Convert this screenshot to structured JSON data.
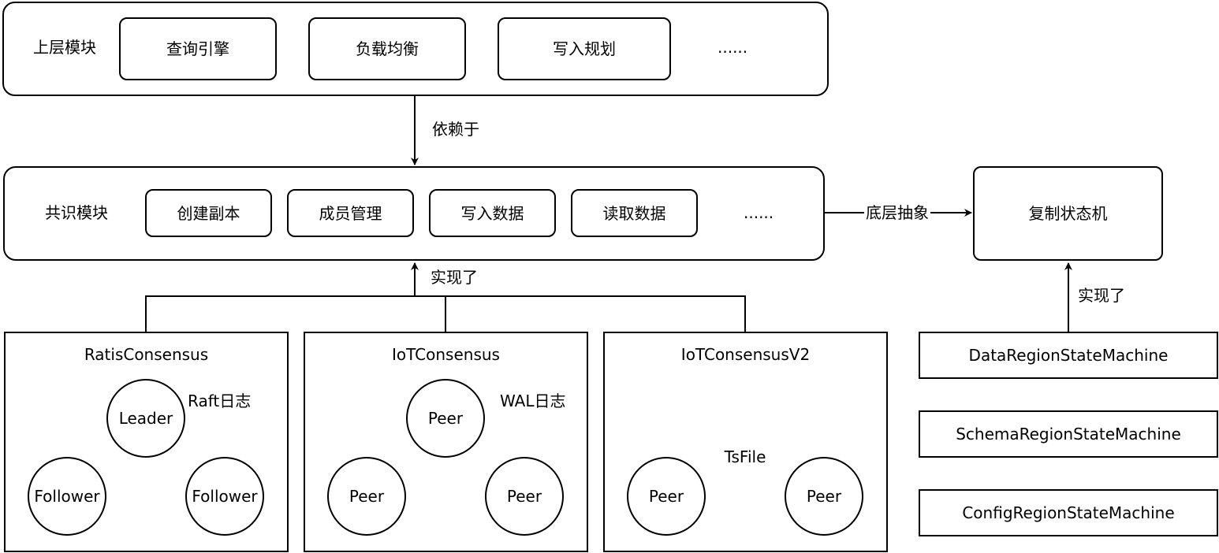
{
  "upper": {
    "title": "上层模块",
    "items": [
      "查询引擎",
      "负载均衡",
      "写入规划"
    ],
    "ellipsis": "......"
  },
  "depends_label": "依赖于",
  "consensus": {
    "title": "共识模块",
    "items": [
      "创建副本",
      "成员管理",
      "写入数据",
      "读取数据"
    ],
    "ellipsis": "......"
  },
  "abstraction_label": "底层抽象",
  "state_machine": {
    "title": "复制状态机"
  },
  "implements_label": "实现了",
  "implements_label_right": "实现了",
  "ratis": {
    "title": "RatisConsensus",
    "leader": "Leader",
    "follower_left": "Follower",
    "follower_right": "Follower",
    "log_label": "Raft日志"
  },
  "iot": {
    "title": "IoTConsensus",
    "peer_top": "Peer",
    "peer_left": "Peer",
    "peer_right": "Peer",
    "log_label": "WAL日志"
  },
  "iotv2": {
    "title": "IoTConsensusV2",
    "peer_left": "Peer",
    "peer_right": "Peer",
    "transfer_label": "TsFile"
  },
  "state_machines": [
    "DataRegionStateMachine",
    "SchemaRegionStateMachine",
    "ConfigRegionStateMachine"
  ]
}
